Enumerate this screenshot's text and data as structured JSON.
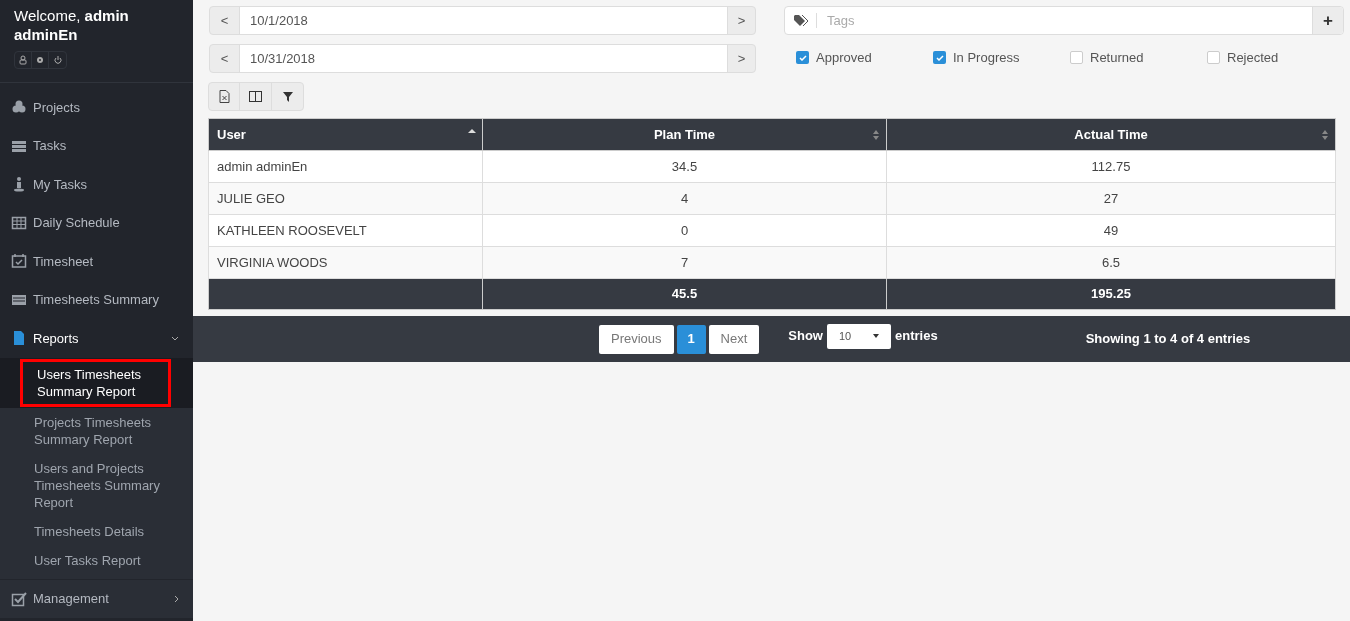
{
  "sidebar": {
    "greeting": "Welcome,",
    "user": "admin adminEn",
    "items": [
      {
        "label": "Projects"
      },
      {
        "label": "Tasks"
      },
      {
        "label": "My Tasks"
      },
      {
        "label": "Daily Schedule"
      },
      {
        "label": "Timesheet"
      },
      {
        "label": "Timesheets Summary"
      },
      {
        "label": "Reports",
        "expanded": true,
        "children": [
          {
            "label": "Users Timesheets Summary Report",
            "selected": true
          },
          {
            "label": "Projects Timesheets Summary Report",
            "selected": false
          },
          {
            "label": "Users and Projects Timesheets Summary Report",
            "selected": false
          },
          {
            "label": "Timesheets Details",
            "selected": false
          },
          {
            "label": "User Tasks Report",
            "selected": false
          }
        ]
      },
      {
        "label": "Management",
        "expanded": false
      }
    ]
  },
  "filters": {
    "dates": [
      {
        "prev": "<",
        "value": "10/1/2018",
        "next": ">"
      },
      {
        "prev": "<",
        "value": "10/31/2018",
        "next": ">"
      }
    ],
    "tags": {
      "placeholder": "Tags",
      "add": "+"
    },
    "statuses": [
      {
        "label": "Approved",
        "checked": true
      },
      {
        "label": "In Progress",
        "checked": true
      },
      {
        "label": "Returned",
        "checked": false
      },
      {
        "label": "Rejected",
        "checked": false
      }
    ]
  },
  "table": {
    "columns": [
      {
        "label": "User",
        "sorted": true
      },
      {
        "label": "Plan Time",
        "sorted": false
      },
      {
        "label": "Actual Time",
        "sorted": false
      }
    ],
    "rows": [
      [
        "admin adminEn",
        "34.5",
        "112.75"
      ],
      [
        "JULIE GEO",
        "4",
        "27"
      ],
      [
        "KATHLEEN ROOSEVELT",
        "0",
        "49"
      ],
      [
        "VIRGINIA WOODS",
        "7",
        "6.5"
      ]
    ],
    "totals": [
      "45.5",
      "195.25"
    ]
  },
  "pagination": {
    "previous": "Previous",
    "pages": [
      {
        "label": "1",
        "selected": true
      }
    ],
    "next": "Next",
    "show": "Show",
    "page_size": "10",
    "entries": "entries",
    "info": "Showing 1 to 4 of 4 entries"
  }
}
